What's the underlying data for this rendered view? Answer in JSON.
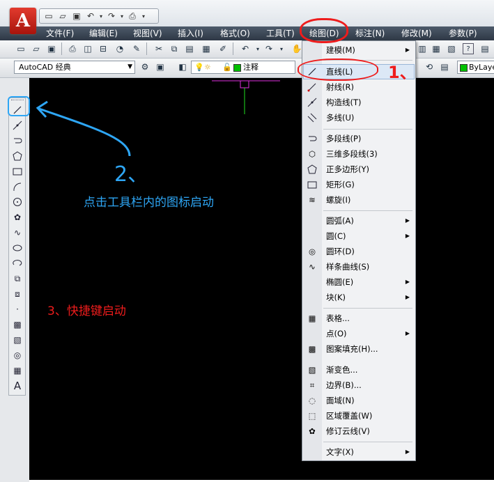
{
  "quick_access": {
    "icons": [
      "new-icon",
      "open-icon",
      "save-icon",
      "undo-icon",
      "redo-icon",
      "plot-icon",
      "dropdown-icon"
    ]
  },
  "menubar": {
    "items": [
      "文件(F)",
      "编辑(E)",
      "视图(V)",
      "插入(I)",
      "格式(O)",
      "工具(T)",
      "绘图(D)",
      "标注(N)",
      "修改(M)",
      "参数(P)"
    ]
  },
  "toolbar2": {
    "workspace": "AutoCAD 经典",
    "layer": "注释",
    "linetype": "ByLaye"
  },
  "colors": {
    "menubar_bg": "#3a4655",
    "canvas_bg": "#000000",
    "annotation_red": "#ee1c1c",
    "annotation_blue": "#2ea6f5",
    "crosshair_magenta": "#e030e0",
    "crosshair_green": "#20e020"
  },
  "dropdown": {
    "items": [
      {
        "label": "建模(M)",
        "icon": "modeling-icon",
        "submenu": true
      },
      {
        "label": "直线(L)",
        "icon": "line-icon",
        "submenu": false,
        "highlighted": true
      },
      {
        "label": "射线(R)",
        "icon": "ray-icon",
        "submenu": false
      },
      {
        "label": "构造线(T)",
        "icon": "construction-line-icon",
        "submenu": false
      },
      {
        "label": "多线(U)",
        "icon": "multiline-icon",
        "submenu": false
      },
      {
        "label": "多段线(P)",
        "icon": "polyline-icon",
        "submenu": false
      },
      {
        "label": "三维多段线(3)",
        "icon": "3d-polyline-icon",
        "submenu": false
      },
      {
        "label": "正多边形(Y)",
        "icon": "polygon-icon",
        "submenu": false
      },
      {
        "label": "矩形(G)",
        "icon": "rectangle-icon",
        "submenu": false
      },
      {
        "label": "螺旋(I)",
        "icon": "helix-icon",
        "submenu": false
      },
      {
        "label": "圆弧(A)",
        "icon": "",
        "submenu": true
      },
      {
        "label": "圆(C)",
        "icon": "",
        "submenu": true
      },
      {
        "label": "圆环(D)",
        "icon": "donut-icon",
        "submenu": false
      },
      {
        "label": "样条曲线(S)",
        "icon": "spline-icon",
        "submenu": false
      },
      {
        "label": "椭圆(E)",
        "icon": "",
        "submenu": true
      },
      {
        "label": "块(K)",
        "icon": "",
        "submenu": true
      },
      {
        "label": "表格...",
        "icon": "table-icon",
        "submenu": false
      },
      {
        "label": "点(O)",
        "icon": "",
        "submenu": true
      },
      {
        "label": "图案填充(H)...",
        "icon": "hatch-icon",
        "submenu": false
      },
      {
        "label": "渐变色...",
        "icon": "gradient-icon",
        "submenu": false
      },
      {
        "label": "边界(B)...",
        "icon": "boundary-icon",
        "submenu": false
      },
      {
        "label": "面域(N)",
        "icon": "region-icon",
        "submenu": false
      },
      {
        "label": "区域覆盖(W)",
        "icon": "wipeout-icon",
        "submenu": false
      },
      {
        "label": "修订云线(V)",
        "icon": "revcloud-icon",
        "submenu": false
      },
      {
        "label": "文字(X)",
        "icon": "",
        "submenu": true
      }
    ]
  },
  "annotations": {
    "step1": "1、",
    "step2": "2、",
    "step2_text": "点击工具栏内的图标启动",
    "step3_text": "3、快捷键启动"
  }
}
